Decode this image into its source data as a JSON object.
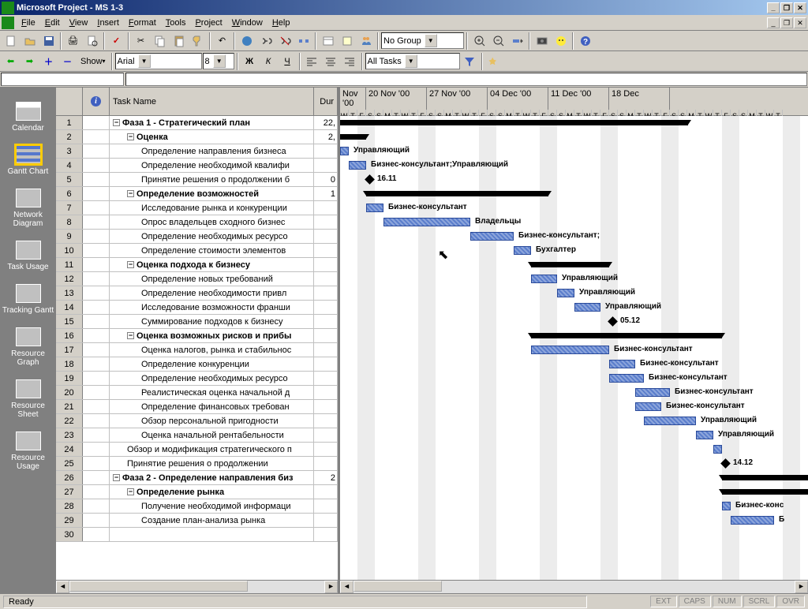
{
  "title": "Microsoft Project - MS 1-3",
  "menu": [
    "File",
    "Edit",
    "View",
    "Insert",
    "Format",
    "Tools",
    "Project",
    "Window",
    "Help"
  ],
  "toolbar2": {
    "show_label": "Show",
    "font": "Arial",
    "size": "8",
    "filter": "All Tasks"
  },
  "toolbar1": {
    "group": "No Group"
  },
  "views": [
    {
      "label": "Calendar",
      "cls": "cal"
    },
    {
      "label": "Gantt Chart",
      "cls": "gantt"
    },
    {
      "label": "Network Diagram",
      "cls": ""
    },
    {
      "label": "Task Usage",
      "cls": ""
    },
    {
      "label": "Tracking Gantt",
      "cls": ""
    },
    {
      "label": "Resource Graph",
      "cls": ""
    },
    {
      "label": "Resource Sheet",
      "cls": ""
    },
    {
      "label": "Resource Usage",
      "cls": ""
    }
  ],
  "grid_headers": {
    "info": "ⓘ",
    "name": "Task Name",
    "dur": "Dur"
  },
  "weeks": [
    "Nov '00",
    "20 Nov '00",
    "27 Nov '00",
    "04 Dec '00",
    "11 Dec '00",
    "18 Dec"
  ],
  "first_week_offset_days": 4,
  "days": [
    "W",
    "T",
    "F",
    "S",
    "S",
    "M",
    "T",
    "W",
    "T",
    "F",
    "S",
    "S",
    "M",
    "T",
    "W",
    "T",
    "F",
    "S",
    "S",
    "M",
    "T",
    "W",
    "T",
    "F",
    "S",
    "S",
    "M",
    "T",
    "W",
    "T",
    "F",
    "S",
    "S",
    "M",
    "T",
    "W",
    "T",
    "F",
    "S",
    "S",
    "M",
    "T",
    "W",
    "T",
    "F",
    "S",
    "S",
    "M",
    "T",
    "W",
    "T"
  ],
  "day_width": 11,
  "rows": [
    {
      "n": 1,
      "bold": true,
      "indent": 0,
      "exp": true,
      "name": "Фаза 1 - Стратегический план",
      "dur": "22,",
      "type": "summary",
      "start": 0,
      "end": 441
    },
    {
      "n": 2,
      "bold": true,
      "indent": 1,
      "exp": true,
      "name": "Оценка",
      "dur": "2,",
      "type": "summary",
      "start": 0,
      "end": 33
    },
    {
      "n": 3,
      "indent": 2,
      "name": "Определение направления бизнеса",
      "type": "task",
      "start": 0,
      "end": 11,
      "label": "Управляющий"
    },
    {
      "n": 4,
      "indent": 2,
      "name": "Определение необходимой квалифи",
      "type": "task",
      "start": 11,
      "end": 33,
      "label": "Бизнес-консультант;Управляющий"
    },
    {
      "n": 5,
      "indent": 2,
      "name": "Принятие решения о продолжении б",
      "dur": "0",
      "type": "milestone",
      "start": 33,
      "label": "16.11"
    },
    {
      "n": 6,
      "bold": true,
      "indent": 1,
      "exp": true,
      "name": "Определение возможностей",
      "dur": "1",
      "type": "summary",
      "start": 33,
      "end": 264
    },
    {
      "n": 7,
      "indent": 2,
      "name": "Исследование рынка и конкуренции",
      "type": "task",
      "start": 33,
      "end": 55,
      "label": "Бизнес-консультант"
    },
    {
      "n": 8,
      "indent": 2,
      "name": "Опрос владельцев сходного бизнес",
      "type": "task",
      "start": 55,
      "end": 165,
      "label": "Владельцы"
    },
    {
      "n": 9,
      "indent": 2,
      "name": "Определение необходимых ресурсо",
      "type": "task",
      "start": 165,
      "end": 220,
      "label": "Бизнес-консультант;"
    },
    {
      "n": 10,
      "indent": 2,
      "name": "Определение стоимости элементов",
      "type": "task",
      "start": 220,
      "end": 242,
      "label": "Бухгалтер"
    },
    {
      "n": 11,
      "bold": true,
      "indent": 1,
      "exp": true,
      "name": "Оценка подхода к бизнесу",
      "type": "summary",
      "start": 242,
      "end": 341
    },
    {
      "n": 12,
      "indent": 2,
      "name": "Определение новых требований",
      "type": "task",
      "start": 242,
      "end": 275,
      "label": "Управляющий"
    },
    {
      "n": 13,
      "indent": 2,
      "name": "Определение необходимости  привл",
      "type": "task",
      "start": 275,
      "end": 297,
      "label": "Управляющий"
    },
    {
      "n": 14,
      "indent": 2,
      "name": "Исследование возможности франши",
      "type": "task",
      "start": 297,
      "end": 330,
      "label": "Управляющий"
    },
    {
      "n": 15,
      "indent": 2,
      "name": "Суммирование подходов к бизнесу",
      "type": "milestone",
      "start": 341,
      "label": "05.12"
    },
    {
      "n": 16,
      "bold": true,
      "indent": 1,
      "exp": true,
      "name": "Оценка возможных рисков и прибы",
      "type": "summary",
      "start": 242,
      "end": 484
    },
    {
      "n": 17,
      "indent": 2,
      "name": "Оценка налогов, рынка и стабильнос",
      "type": "task",
      "start": 242,
      "end": 341,
      "label": "Бизнес-консультант"
    },
    {
      "n": 18,
      "indent": 2,
      "name": "Определение конкуренции",
      "type": "task",
      "start": 341,
      "end": 374,
      "label": "Бизнес-консультант"
    },
    {
      "n": 19,
      "indent": 2,
      "name": "Определение необходимых ресурсо",
      "type": "task",
      "start": 341,
      "end": 385,
      "label": "Бизнес-консультант"
    },
    {
      "n": 20,
      "indent": 2,
      "name": "Реалистическая оценка начальной д",
      "type": "task",
      "start": 374,
      "end": 418,
      "label": "Бизнес-консультант"
    },
    {
      "n": 21,
      "indent": 2,
      "name": "Определение финансовых требован",
      "type": "task",
      "start": 374,
      "end": 407,
      "label": "Бизнес-консультант"
    },
    {
      "n": 22,
      "indent": 2,
      "name": "Обзор персональной пригодности",
      "type": "task",
      "start": 385,
      "end": 451,
      "label": "Управляющий"
    },
    {
      "n": 23,
      "indent": 2,
      "name": "Оценка начальной рентабельности",
      "type": "task",
      "start": 451,
      "end": 473,
      "label": "Управляющий"
    },
    {
      "n": 24,
      "indent": 1,
      "name": "Обзор и модификация стратегического п",
      "type": "task",
      "start": 473,
      "end": 484
    },
    {
      "n": 25,
      "indent": 1,
      "name": "Принятие решения о продолжении",
      "type": "milestone",
      "start": 484,
      "label": "14.12"
    },
    {
      "n": 26,
      "bold": true,
      "indent": 0,
      "exp": true,
      "name": "Фаза 2 - Определение направления биз",
      "dur": "2",
      "type": "summary",
      "start": 484,
      "end": 593
    },
    {
      "n": 27,
      "bold": true,
      "indent": 1,
      "exp": true,
      "name": "Определение рынка",
      "type": "summary",
      "start": 484,
      "end": 593
    },
    {
      "n": 28,
      "indent": 2,
      "name": "Получение необходимой информаци",
      "type": "task",
      "start": 484,
      "end": 495,
      "label": "Бизнес-конс"
    },
    {
      "n": 29,
      "indent": 2,
      "name": "Создание план-анализа рынка",
      "type": "task",
      "start": 495,
      "end": 550,
      "label": "Б"
    },
    {
      "n": 30,
      "indent": 2,
      "name": "",
      "type": "",
      "start": 0,
      "end": 0
    }
  ],
  "status": {
    "ready": "Ready",
    "ext": "EXT",
    "caps": "CAPS",
    "num": "NUM",
    "scrl": "SCRL",
    "ovr": "OVR"
  }
}
